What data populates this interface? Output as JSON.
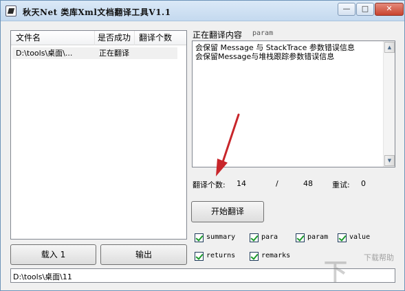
{
  "window": {
    "title": "秋天Net 类库Xml文档翻译工具V1.1",
    "min_glyph": "—",
    "max_glyph": "□",
    "close_glyph": "✕"
  },
  "file_list": {
    "columns": [
      "文件名",
      "是否成功",
      "翻译个数"
    ],
    "rows": [
      {
        "filename": "D:\\tools\\桌面\\...",
        "status": "正在翻译",
        "count": ""
      }
    ]
  },
  "translation": {
    "label": "正在翻译内容",
    "current_item": "param",
    "text": "会保留 Message 与 StackTrace 参数错误信息\n会保留Message与堆栈跟踪参数错误信息",
    "scroll_up": "▲",
    "scroll_down": "▼"
  },
  "stats": {
    "count_label": "翻译个数:",
    "done": "14",
    "separator": "/",
    "total": "48",
    "retry_label": "重试:",
    "retry": "0"
  },
  "buttons": {
    "start": "开始翻译",
    "load": "载入 1",
    "export": "输出"
  },
  "options": [
    {
      "name": "summary",
      "checked": true
    },
    {
      "name": "para",
      "checked": true
    },
    {
      "name": "param",
      "checked": true
    },
    {
      "name": "value",
      "checked": true
    },
    {
      "name": "returns",
      "checked": true
    },
    {
      "name": "remarks",
      "checked": true
    }
  ],
  "status_bar": {
    "path": "D:\\tools\\桌面\\11"
  },
  "watermark": {
    "text": "下载帮助"
  },
  "colors": {
    "accent_arrow": "#c8262b",
    "checkmark": "#1a9a2a",
    "title_gradient_top": "#dbe9f7"
  }
}
